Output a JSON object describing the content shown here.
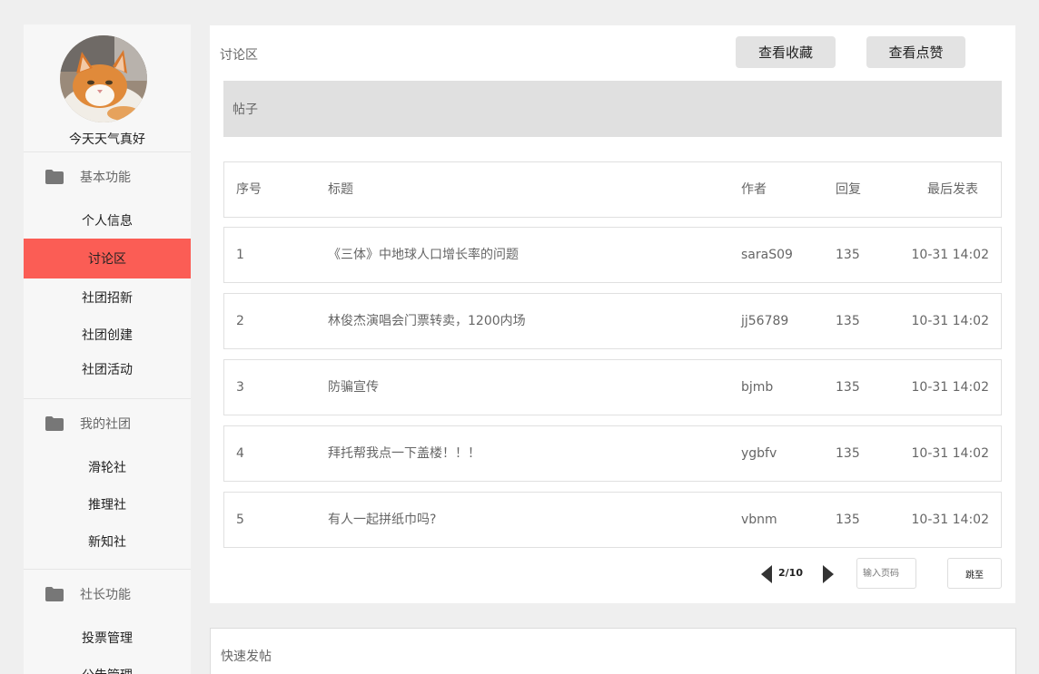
{
  "sidebar": {
    "username": "今天天气真好",
    "groups": [
      {
        "label": "基本功能",
        "icon": "folder-icon",
        "items": [
          {
            "label": "个人信息"
          },
          {
            "label": "讨论区",
            "active": true
          },
          {
            "label": "社团招新"
          },
          {
            "label": "社团创建"
          },
          {
            "label": "社团活动"
          }
        ]
      },
      {
        "label": "我的社团",
        "icon": "folder-icon",
        "items": [
          {
            "label": "滑轮社"
          },
          {
            "label": "推理社"
          },
          {
            "label": "新知社"
          }
        ]
      },
      {
        "label": "社长功能",
        "icon": "folder-icon",
        "items": [
          {
            "label": "投票管理"
          },
          {
            "label": "公告管理"
          }
        ]
      }
    ]
  },
  "main": {
    "title": "讨论区",
    "favorites_button": "查看收藏",
    "likes_button": "查看点赞",
    "section_label": "帖子",
    "table": {
      "headers": {
        "no": "序号",
        "title": "标题",
        "author": "作者",
        "replies": "回复",
        "last": "最后发表"
      },
      "rows": [
        {
          "no": "1",
          "title": "《三体》中地球人口增长率的问题",
          "author": "saraS09",
          "replies": "135",
          "last": "10-31 14:02"
        },
        {
          "no": "2",
          "title": "林俊杰演唱会门票转卖，1200内场",
          "author": "jj56789",
          "replies": "135",
          "last": "10-31 14:02"
        },
        {
          "no": "3",
          "title": "防骗宣传",
          "author": "bjmb",
          "replies": "135",
          "last": "10-31 14:02"
        },
        {
          "no": "4",
          "title": "拜托帮我点一下盖楼！！！",
          "author": "ygbfv",
          "replies": "135",
          "last": "10-31 14:02"
        },
        {
          "no": "5",
          "title": "有人一起拼纸巾吗?",
          "author": "vbnm",
          "replies": "135",
          "last": "10-31 14:02"
        }
      ]
    },
    "pagination": {
      "page_text": "2/10",
      "input_placeholder": "输入页码",
      "go_label": "跳至"
    }
  },
  "quick_post": {
    "title": "快速发帖"
  },
  "colors": {
    "active_nav": "#fb5d55",
    "section_bar": "#e0e0e0",
    "button_bg": "#e3e3e3"
  }
}
